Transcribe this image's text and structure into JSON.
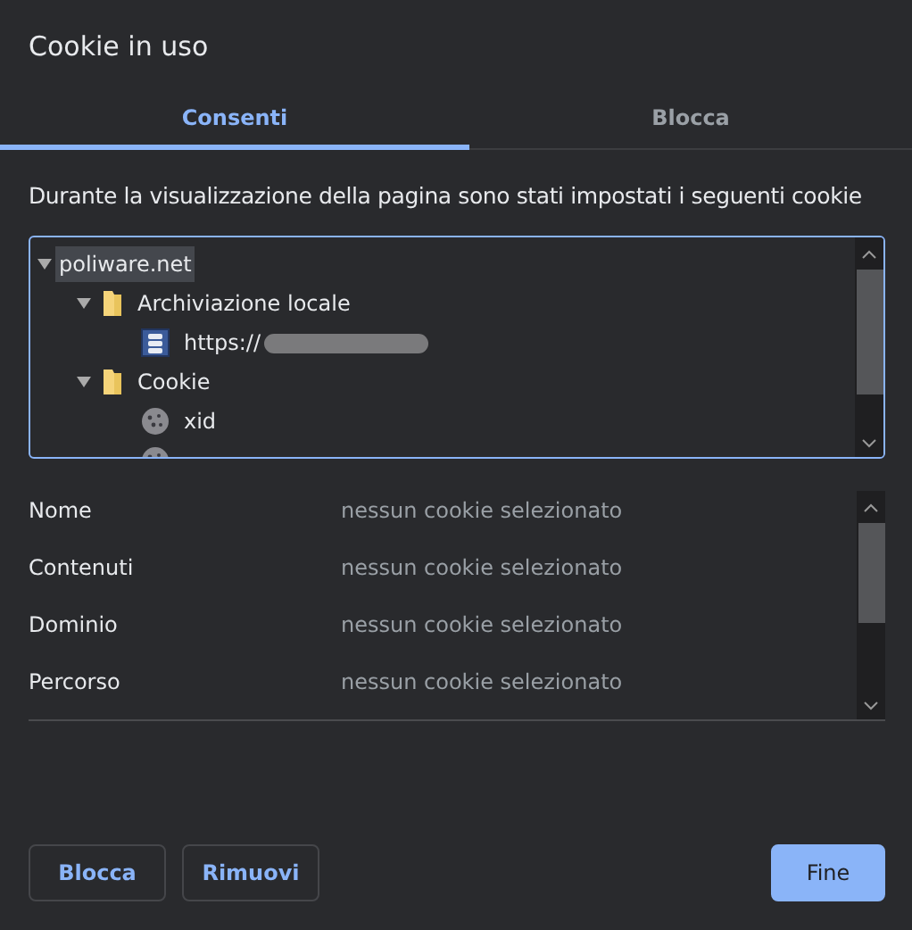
{
  "window": {
    "title": "Cookie in uso"
  },
  "tabs": [
    {
      "label": "Consenti",
      "selected": true
    },
    {
      "label": "Blocca",
      "selected": false
    }
  ],
  "description": "Durante la visualizzazione della pagina sono stati impostati i seguenti cookie",
  "tree": [
    {
      "label": "poliware.net",
      "selected": true,
      "expanded": true,
      "children": [
        {
          "label": "Archiviazione locale",
          "kind": "folder",
          "selected": false,
          "expanded": true,
          "children": [
            {
              "label": "https://",
              "kind": "storage",
              "selected": false,
              "redacted": true
            }
          ]
        },
        {
          "label": "Cookie",
          "kind": "folder",
          "selected": false,
          "expanded": true,
          "children": [
            {
              "label": "xid",
              "kind": "cookie",
              "selected": false
            },
            {
              "kind": "cookie"
            }
          ]
        }
      ]
    }
  ],
  "details": [
    {
      "label": "Nome",
      "value": "nessun cookie selezionato"
    },
    {
      "label": "Contenuti",
      "value": "nessun cookie selezionato"
    },
    {
      "label": "Dominio",
      "value": "nessun cookie selezionato"
    },
    {
      "label": "Percorso",
      "value": "nessun cookie selezionato"
    }
  ],
  "buttons": [
    {
      "label": "Blocca",
      "kind": "secondary"
    },
    {
      "label": "Rimuovi",
      "kind": "secondary"
    },
    {
      "label": "Fine",
      "kind": "primary"
    }
  ]
}
